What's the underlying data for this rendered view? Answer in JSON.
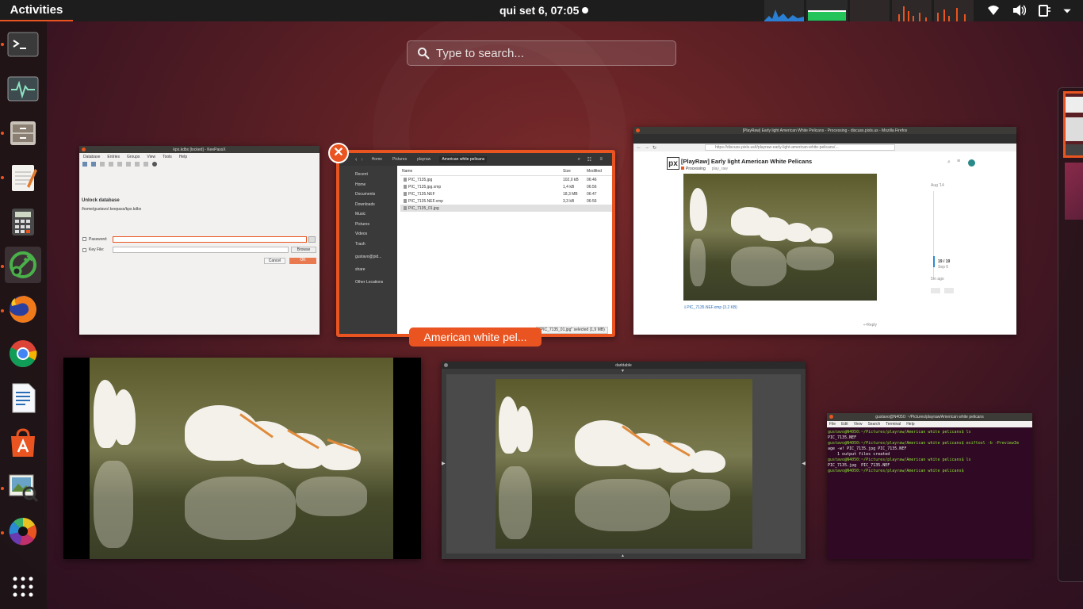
{
  "topbar": {
    "activities_label": "Activities",
    "clock": "qui set  6, 07:05",
    "tray_icons": [
      "wifi-icon",
      "volume-icon",
      "power-icon",
      "menu-arrow-icon"
    ]
  },
  "dock": {
    "items": [
      {
        "name": "terminal",
        "running": true
      },
      {
        "name": "system-monitor",
        "running": false
      },
      {
        "name": "files",
        "running": true
      },
      {
        "name": "text-editor",
        "running": true
      },
      {
        "name": "calculator",
        "running": false
      },
      {
        "name": "keepassx",
        "running": true
      },
      {
        "name": "firefox",
        "running": true
      },
      {
        "name": "chrome",
        "running": false
      },
      {
        "name": "libreoffice-writer",
        "running": false
      },
      {
        "name": "ubuntu-software",
        "running": false
      },
      {
        "name": "image-viewer",
        "running": true
      },
      {
        "name": "darktable",
        "running": true
      },
      {
        "name": "show-applications",
        "running": false
      }
    ]
  },
  "search": {
    "placeholder": "Type to search..."
  },
  "keepass": {
    "title": "kpx.kdbx [locked] - KeePassX",
    "menu": [
      "Database",
      "Entries",
      "Groups",
      "View",
      "Tools",
      "Help"
    ],
    "heading": "Unlock database",
    "path": "/home/gustavo/.keepass/kpx.kdbx",
    "password_label": "Password:",
    "keyfile_label": "Key File:",
    "browse": "Browse",
    "cancel": "Cancel",
    "ok": "OK"
  },
  "files": {
    "crumbs": [
      "Home",
      "Pictures",
      "playraw",
      "American white pelicans"
    ],
    "sidebar": [
      "Recent",
      "Home",
      "Documents",
      "Downloads",
      "Music",
      "Pictures",
      "Videos",
      "Trash",
      "gustavo@pid...",
      "share",
      "Other Locations"
    ],
    "columns": [
      "Name",
      "Size",
      "Modified"
    ],
    "rows": [
      {
        "name": "PIC_7135.jpg",
        "size": "102,0 kB",
        "mod": "06:46"
      },
      {
        "name": "PIC_7135.jpg.xmp",
        "size": "1,4 kB",
        "mod": "06:56"
      },
      {
        "name": "PIC_7135.NEF",
        "size": "18,3 MB",
        "mod": "06:47"
      },
      {
        "name": "PIC_7135.NEF.xmp",
        "size": "3,3 kB",
        "mod": "06:56"
      },
      {
        "name": "PIC_7135_01.jpg",
        "size": "",
        "mod": ""
      }
    ],
    "status": "\"PIC_7135_01.jpg\" selected (1,9 MB)",
    "label": "American white pel..."
  },
  "firefox": {
    "title": "[PlayRaw] Early light American White Pelicans - Processing - discuss.pixls.us - Mozilla Firefox",
    "url": "https://discuss.pixls.us/t/playraw-early-light-american-white-pelicans/...",
    "logo": "px",
    "topic_title": "[PlayRaw] Early light American White Pelicans",
    "category": "Processing",
    "tag": "play_raw",
    "timeline_top": "Aug '14",
    "timeline_pos": "19 / 19",
    "timeline_date": "Sep 6",
    "timeline_ago": "5m ago",
    "attachment": "PIC_7135.NEF.xmp (3.2 KB)",
    "reply": "Reply"
  },
  "darktable": {
    "title": "darktable"
  },
  "terminal": {
    "title": "gustavo@N4050: ~/Pictures/playraw/American white pelicans",
    "menu": [
      "File",
      "Edit",
      "View",
      "Search",
      "Terminal",
      "Help"
    ],
    "lines": [
      "gustavo@N4050:~/Pictures/playraw/American white pelicans$ ls",
      "PIC_7135.NEF",
      "gustavo@N4050:~/Pictures/playraw/American white pelicans$ exiftool -b -PreviewIm",
      "age -w! PIC_7135.jpg PIC_7135.NEF",
      "    1 output files created",
      "gustavo@N4050:~/Pictures/playraw/American white pelicans$ ls",
      "PIC_7135.jpg  PIC_7135.NEF",
      "gustavo@N4050:~/Pictures/playraw/American white pelicans$ "
    ]
  },
  "colors": {
    "accent": "#e95420",
    "topbar": "#1d1d1d",
    "terminal_bg": "#300a24"
  }
}
